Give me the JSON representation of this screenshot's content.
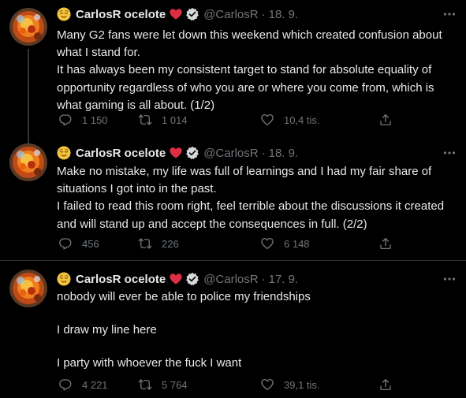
{
  "tweets": [
    {
      "author": {
        "name": "CarlosR ocelote",
        "handle": "@CarlosR",
        "emoji": "relieved-face-emoji"
      },
      "separator": "·",
      "date": "18. 9.",
      "text_lines": [
        "Many G2 fans were let down this weekend which created confusion about what I stand for.",
        "It has always been my consistent target to stand for absolute equality of opportunity regardless of who you are or where you come from, which is what gaming is all about. (1/2)"
      ],
      "stats": {
        "replies": "1 150",
        "retweets": "1 014",
        "likes": "10,4 tis."
      }
    },
    {
      "author": {
        "name": "CarlosR ocelote",
        "handle": "@CarlosR",
        "emoji": "relieved-face-emoji"
      },
      "separator": "·",
      "date": "18. 9.",
      "text_lines": [
        "Make no mistake, my life was full of learnings and I had my fair share of situations I got into in the past.",
        "I failed to read this room right, feel terrible about the discussions it created and will stand up and accept the consequences in full. (2/2)"
      ],
      "stats": {
        "replies": "456",
        "retweets": "226",
        "likes": "6 148"
      }
    },
    {
      "author": {
        "name": "CarlosR ocelote",
        "handle": "@CarlosR",
        "emoji": "relieved-face-emoji"
      },
      "separator": "·",
      "date": "17. 9.",
      "text_lines": [
        "nobody will ever be able to police my friendships",
        "I draw my line here",
        "I party with whoever the fuck I want"
      ],
      "stats": {
        "replies": "4 221",
        "retweets": "5 764",
        "likes": "39,1 tis."
      }
    }
  ],
  "colors": {
    "background": "#000000",
    "text_primary": "#e7e9ea",
    "text_secondary": "#71767b",
    "divider": "#2f3336",
    "heart": "#f91880",
    "emoji": "#f5c33b"
  },
  "icons": [
    "reply-icon",
    "retweet-icon",
    "like-icon",
    "share-icon",
    "more-icon",
    "verified-badge-icon",
    "red-heart-emoji"
  ]
}
